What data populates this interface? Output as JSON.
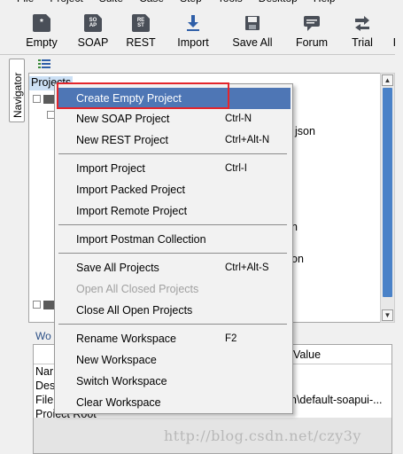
{
  "menubar": {
    "items": [
      "File",
      "Project",
      "Suite",
      "Case",
      "Step",
      "Tools",
      "Desktop",
      "Help"
    ]
  },
  "toolbar": {
    "buttons": [
      {
        "label": "Empty",
        "icon": "new-empty-project-icon",
        "glyph": "*"
      },
      {
        "label": "SOAP",
        "icon": "soap-project-icon",
        "glyph": "SO AP"
      },
      {
        "label": "REST",
        "icon": "rest-project-icon",
        "glyph": "RE ST"
      },
      {
        "label": "Import",
        "icon": "import-arrow-icon"
      },
      {
        "label": "Save All",
        "icon": "save-all-icon"
      },
      {
        "label": "Forum",
        "icon": "forum-chat-icon"
      },
      {
        "label": "Trial",
        "icon": "trial-arrows-icon"
      },
      {
        "label": "Pr",
        "icon": "preferences-icon"
      }
    ]
  },
  "navigator": {
    "tab_label": "Navigator"
  },
  "tree": {
    "root_label": "Projects",
    "fragments": [
      "json",
      "n",
      "on"
    ]
  },
  "inspector": {
    "tab_label": "Wo",
    "value_header": "Value",
    "rows": [
      "Nar",
      "Des",
      "File",
      "Project Root"
    ],
    "file_value": "n\\default-soapui-..."
  },
  "context_menu": {
    "items": [
      {
        "label": "Create Empty Project",
        "accel": "",
        "highlighted": true,
        "disabled": false
      },
      {
        "label": "New SOAP Project",
        "accel": "Ctrl-N",
        "highlighted": false,
        "disabled": false
      },
      {
        "label": "New REST Project",
        "accel": "Ctrl+Alt-N",
        "highlighted": false,
        "disabled": false
      },
      {
        "label": "Import Project",
        "accel": "Ctrl-I",
        "highlighted": false,
        "disabled": false
      },
      {
        "label": "Import Packed Project",
        "accel": "",
        "highlighted": false,
        "disabled": false
      },
      {
        "label": "Import Remote Project",
        "accel": "",
        "highlighted": false,
        "disabled": false
      },
      {
        "label": "Import Postman Collection",
        "accel": "",
        "highlighted": false,
        "disabled": false
      },
      {
        "label": "Save All Projects",
        "accel": "Ctrl+Alt-S",
        "highlighted": false,
        "disabled": false
      },
      {
        "label": "Open All Closed Projects",
        "accel": "",
        "highlighted": false,
        "disabled": true
      },
      {
        "label": "Close All Open Projects",
        "accel": "",
        "highlighted": false,
        "disabled": false
      },
      {
        "label": "Rename Workspace",
        "accel": "F2",
        "highlighted": false,
        "disabled": false
      },
      {
        "label": "New Workspace",
        "accel": "",
        "highlighted": false,
        "disabled": false
      },
      {
        "label": "Switch Workspace",
        "accel": "",
        "highlighted": false,
        "disabled": false
      },
      {
        "label": "Clear Workspace",
        "accel": "",
        "highlighted": false,
        "disabled": false
      }
    ]
  },
  "colors": {
    "highlight": "#4e76b5",
    "annotation_box": "#e4252b",
    "scroll_thumb": "#4a82c8"
  },
  "watermark": "http://blog.csdn.net/czy3y"
}
